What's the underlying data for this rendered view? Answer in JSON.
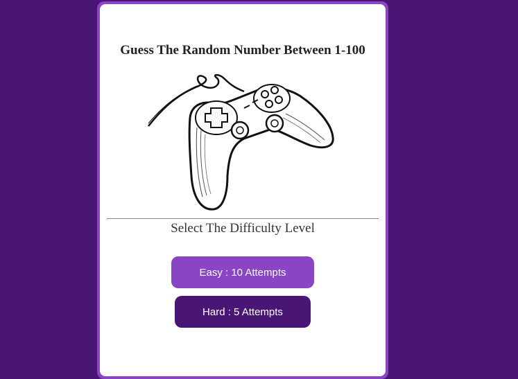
{
  "app": {
    "title": "Guess The Random Number Between 1-100",
    "subtitle": "Select The Difficulty Level"
  },
  "difficulty": {
    "easy_label": "Easy : 10 Attempts",
    "hard_label": "Hard : 5 Attempts"
  },
  "image": {
    "icon": "game-controller-icon"
  },
  "colors": {
    "background": "#4a1676",
    "accent_light": "#8a45c4",
    "accent_dark": "#4a1676",
    "card": "#ffffff"
  }
}
